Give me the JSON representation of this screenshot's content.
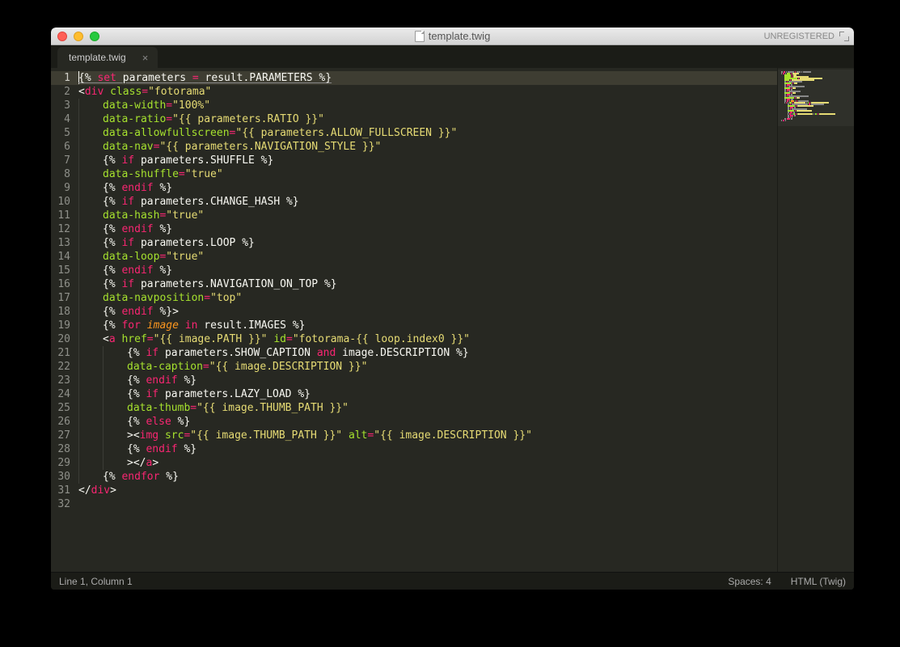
{
  "window": {
    "title": "template.twig",
    "registration": "UNREGISTERED"
  },
  "tab": {
    "title": "template.twig"
  },
  "statusbar": {
    "position": "Line 1, Column 1",
    "spaces": "Spaces: 4",
    "syntax": "HTML (Twig)"
  },
  "code": {
    "line_count": 32,
    "active_line": 1,
    "lines": [
      {
        "n": 1,
        "indent": 0,
        "tokens": [
          [
            "pun",
            "{% "
          ],
          [
            "kw",
            "set"
          ],
          [
            "pun",
            " "
          ],
          [
            "pun",
            "parameters "
          ],
          [
            "op",
            "="
          ],
          [
            "pun",
            " result"
          ],
          [
            "pun",
            "."
          ],
          [
            "pun",
            "PARAMETERS %}"
          ]
        ],
        "underline": true
      },
      {
        "n": 2,
        "indent": 0,
        "tokens": [
          [
            "pun",
            "<"
          ],
          [
            "tag",
            "div"
          ],
          [
            "pun",
            " "
          ],
          [
            "attr",
            "class"
          ],
          [
            "op",
            "="
          ],
          [
            "str",
            "\"fotorama\""
          ]
        ]
      },
      {
        "n": 3,
        "indent": 1,
        "tokens": [
          [
            "attr",
            "data-width"
          ],
          [
            "op",
            "="
          ],
          [
            "str",
            "\"100%\""
          ]
        ]
      },
      {
        "n": 4,
        "indent": 1,
        "tokens": [
          [
            "attr",
            "data-ratio"
          ],
          [
            "op",
            "="
          ],
          [
            "str",
            "\"{{ parameters.RATIO }}\""
          ]
        ]
      },
      {
        "n": 5,
        "indent": 1,
        "tokens": [
          [
            "attr",
            "data-allowfullscreen"
          ],
          [
            "op",
            "="
          ],
          [
            "str",
            "\"{{ parameters.ALLOW_FULLSCREEN }}\""
          ]
        ]
      },
      {
        "n": 6,
        "indent": 1,
        "tokens": [
          [
            "attr",
            "data-nav"
          ],
          [
            "op",
            "="
          ],
          [
            "str",
            "\"{{ parameters.NAVIGATION_STYLE }}\""
          ]
        ]
      },
      {
        "n": 7,
        "indent": 1,
        "tokens": [
          [
            "pun",
            "{% "
          ],
          [
            "kw",
            "if"
          ],
          [
            "pun",
            " parameters.SHUFFLE %}"
          ]
        ]
      },
      {
        "n": 8,
        "indent": 1,
        "tokens": [
          [
            "attr",
            "data-shuffle"
          ],
          [
            "op",
            "="
          ],
          [
            "str",
            "\"true\""
          ]
        ]
      },
      {
        "n": 9,
        "indent": 1,
        "tokens": [
          [
            "pun",
            "{% "
          ],
          [
            "kw",
            "endif"
          ],
          [
            "pun",
            " %}"
          ]
        ]
      },
      {
        "n": 10,
        "indent": 1,
        "tokens": [
          [
            "pun",
            "{% "
          ],
          [
            "kw",
            "if"
          ],
          [
            "pun",
            " parameters.CHANGE_HASH %}"
          ]
        ]
      },
      {
        "n": 11,
        "indent": 1,
        "tokens": [
          [
            "attr",
            "data-hash"
          ],
          [
            "op",
            "="
          ],
          [
            "str",
            "\"true\""
          ]
        ]
      },
      {
        "n": 12,
        "indent": 1,
        "tokens": [
          [
            "pun",
            "{% "
          ],
          [
            "kw",
            "endif"
          ],
          [
            "pun",
            " %}"
          ]
        ]
      },
      {
        "n": 13,
        "indent": 1,
        "tokens": [
          [
            "pun",
            "{% "
          ],
          [
            "kw",
            "if"
          ],
          [
            "pun",
            " parameters.LOOP %}"
          ]
        ]
      },
      {
        "n": 14,
        "indent": 1,
        "tokens": [
          [
            "attr",
            "data-loop"
          ],
          [
            "op",
            "="
          ],
          [
            "str",
            "\"true\""
          ]
        ]
      },
      {
        "n": 15,
        "indent": 1,
        "tokens": [
          [
            "pun",
            "{% "
          ],
          [
            "kw",
            "endif"
          ],
          [
            "pun",
            " %}"
          ]
        ]
      },
      {
        "n": 16,
        "indent": 1,
        "tokens": [
          [
            "pun",
            "{% "
          ],
          [
            "kw",
            "if"
          ],
          [
            "pun",
            " parameters.NAVIGATION_ON_TOP %}"
          ]
        ]
      },
      {
        "n": 17,
        "indent": 1,
        "tokens": [
          [
            "attr",
            "data-navposition"
          ],
          [
            "op",
            "="
          ],
          [
            "str",
            "\"top\""
          ]
        ]
      },
      {
        "n": 18,
        "indent": 1,
        "tokens": [
          [
            "pun",
            "{% "
          ],
          [
            "kw",
            "endif"
          ],
          [
            "pun",
            " %}>"
          ]
        ]
      },
      {
        "n": 19,
        "indent": 1,
        "tokens": [
          [
            "pun",
            "{% "
          ],
          [
            "kw",
            "for"
          ],
          [
            "pun",
            " "
          ],
          [
            "var",
            "image"
          ],
          [
            "pun",
            " "
          ],
          [
            "kw",
            "in"
          ],
          [
            "pun",
            " result.IMAGES %}"
          ]
        ]
      },
      {
        "n": 20,
        "indent": 1,
        "tokens": [
          [
            "pun",
            "<"
          ],
          [
            "tag",
            "a"
          ],
          [
            "pun",
            " "
          ],
          [
            "attr",
            "href"
          ],
          [
            "op",
            "="
          ],
          [
            "str",
            "\"{{ image.PATH }}\""
          ],
          [
            "pun",
            " "
          ],
          [
            "attr",
            "id"
          ],
          [
            "op",
            "="
          ],
          [
            "str",
            "\"fotorama-{{ loop.index0 }}\""
          ]
        ]
      },
      {
        "n": 21,
        "indent": 2,
        "tokens": [
          [
            "pun",
            "{% "
          ],
          [
            "kw",
            "if"
          ],
          [
            "pun",
            " parameters.SHOW_CAPTION "
          ],
          [
            "kw",
            "and"
          ],
          [
            "pun",
            " image.DESCRIPTION %}"
          ]
        ]
      },
      {
        "n": 22,
        "indent": 2,
        "tokens": [
          [
            "attr",
            "data-caption"
          ],
          [
            "op",
            "="
          ],
          [
            "str",
            "\"{{ image.DESCRIPTION }}\""
          ]
        ]
      },
      {
        "n": 23,
        "indent": 2,
        "tokens": [
          [
            "pun",
            "{% "
          ],
          [
            "kw",
            "endif"
          ],
          [
            "pun",
            " %}"
          ]
        ]
      },
      {
        "n": 24,
        "indent": 2,
        "tokens": [
          [
            "pun",
            "{% "
          ],
          [
            "kw",
            "if"
          ],
          [
            "pun",
            " parameters.LAZY_LOAD %}"
          ]
        ]
      },
      {
        "n": 25,
        "indent": 2,
        "tokens": [
          [
            "attr",
            "data-thumb"
          ],
          [
            "op",
            "="
          ],
          [
            "str",
            "\"{{ image.THUMB_PATH }}\""
          ]
        ]
      },
      {
        "n": 26,
        "indent": 2,
        "tokens": [
          [
            "pun",
            "{% "
          ],
          [
            "kw",
            "else"
          ],
          [
            "pun",
            " %}"
          ]
        ]
      },
      {
        "n": 27,
        "indent": 2,
        "tokens": [
          [
            "pun",
            "><"
          ],
          [
            "tag",
            "img"
          ],
          [
            "pun",
            " "
          ],
          [
            "attr",
            "src"
          ],
          [
            "op",
            "="
          ],
          [
            "str",
            "\"{{ image.THUMB_PATH }}\""
          ],
          [
            "pun",
            " "
          ],
          [
            "attr",
            "alt"
          ],
          [
            "op",
            "="
          ],
          [
            "str",
            "\"{{ image.DESCRIPTION }}\""
          ]
        ]
      },
      {
        "n": 28,
        "indent": 2,
        "tokens": [
          [
            "pun",
            "{% "
          ],
          [
            "kw",
            "endif"
          ],
          [
            "pun",
            " %}"
          ]
        ]
      },
      {
        "n": 29,
        "indent": 2,
        "tokens": [
          [
            "pun",
            "></"
          ],
          [
            "tag",
            "a"
          ],
          [
            "pun",
            ">"
          ]
        ]
      },
      {
        "n": 30,
        "indent": 1,
        "tokens": [
          [
            "pun",
            "{% "
          ],
          [
            "kw",
            "endfor"
          ],
          [
            "pun",
            " %}"
          ]
        ]
      },
      {
        "n": 31,
        "indent": 0,
        "tokens": [
          [
            "pun",
            "</"
          ],
          [
            "tag",
            "div"
          ],
          [
            "pun",
            ">"
          ]
        ]
      },
      {
        "n": 32,
        "indent": 0,
        "tokens": []
      }
    ]
  },
  "colors": {
    "bg": "#272822",
    "kw": "#f92672",
    "attr": "#a6e22e",
    "str": "#e6db74",
    "var": "#fd971f",
    "tag": "#f92672"
  }
}
